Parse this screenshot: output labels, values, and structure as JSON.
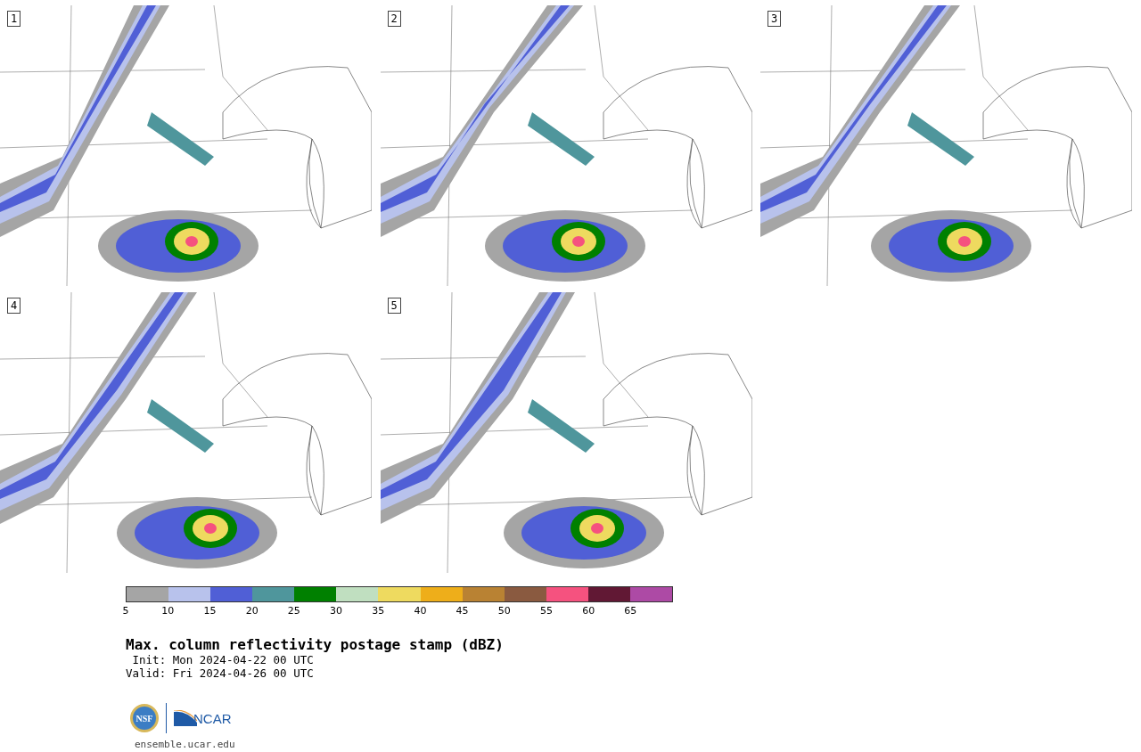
{
  "panels": [
    {
      "label": "1",
      "kind": "picture"
    },
    {
      "label": "2",
      "kind": "picture"
    },
    {
      "label": "3",
      "kind": "picture"
    },
    {
      "label": "4",
      "kind": "picture"
    },
    {
      "label": "5",
      "kind": "picture"
    }
  ],
  "colorbar": {
    "bins": [
      {
        "color": "#a5a5a5"
      },
      {
        "color": "#b8c2ec"
      },
      {
        "color": "#505fd6"
      },
      {
        "color": "#4f969c"
      },
      {
        "color": "#008000"
      },
      {
        "color": "#c0dfc0"
      },
      {
        "color": "#eeda5f"
      },
      {
        "color": "#eeae1a"
      },
      {
        "color": "#b98233"
      },
      {
        "color": "#8a5a40"
      },
      {
        "color": "#f5527f"
      },
      {
        "color": "#611834"
      },
      {
        "color": "#ad4aa5"
      }
    ],
    "ticks": [
      "5",
      "10",
      "15",
      "20",
      "25",
      "30",
      "35",
      "40",
      "45",
      "50",
      "55",
      "60",
      "65"
    ]
  },
  "title": "Max. column reflectivity postage stamp (dBZ)",
  "init": " Init: Mon 2024-04-22 00 UTC",
  "valid": "Valid: Fri 2024-04-26 00 UTC",
  "logos": {
    "nsf": "NSF",
    "ncar": "NCAR"
  },
  "url": "ensemble.ucar.edu"
}
